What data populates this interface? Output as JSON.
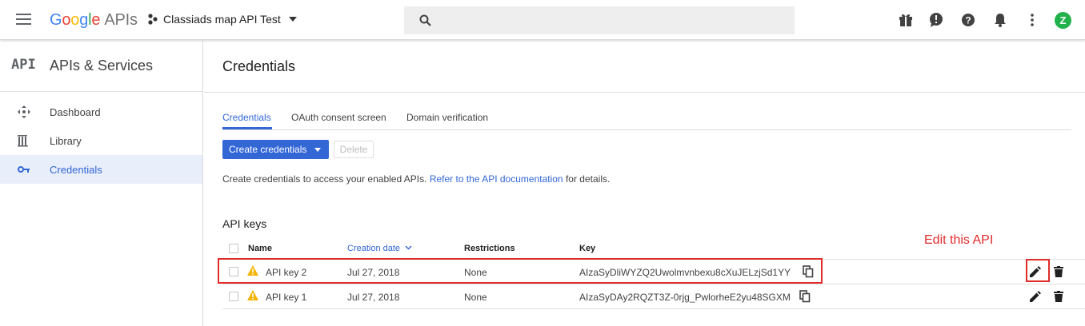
{
  "header": {
    "logo_google": "Google",
    "logo_apis": "APIs",
    "project_name": "Classiads map API Test",
    "search_placeholder": "",
    "avatar_letter": "Z",
    "colors": {
      "brand_blue": "#4285f4",
      "accent": "#3367d6",
      "avatar_green": "#22b24c"
    }
  },
  "sidebar": {
    "badge": "API",
    "title": "APIs & Services",
    "items": [
      {
        "label": "Dashboard",
        "icon": "dashboard-icon"
      },
      {
        "label": "Library",
        "icon": "library-icon"
      },
      {
        "label": "Credentials",
        "icon": "key-icon",
        "active": true
      }
    ]
  },
  "main": {
    "title": "Credentials",
    "tabs": [
      {
        "label": "Credentials",
        "active": true
      },
      {
        "label": "OAuth consent screen"
      },
      {
        "label": "Domain verification"
      }
    ],
    "create_button": "Create credentials",
    "delete_button": "Delete",
    "info_text": "Create credentials to access your enabled APIs.",
    "info_link": "Refer to the API documentation",
    "info_suffix": "for details.",
    "section_title": "API keys",
    "table": {
      "columns": [
        "Name",
        "Creation date",
        "Restrictions",
        "Key"
      ],
      "rows": [
        {
          "name": "API key 2",
          "date": "Jul 27, 2018",
          "restrictions": "None",
          "key": "AIzaSyDliWYZQ2Uwolmvnbexu8cXuJELzjSd1YY"
        },
        {
          "name": "API key 1",
          "date": "Jul 27, 2018",
          "restrictions": "None",
          "key": "AIzaSyDAy2RQZT3Z-0rjg_PwlorheE2yu48SGXM"
        }
      ]
    }
  },
  "annotation": {
    "text": "Edit this API",
    "color": "#e12b2b"
  }
}
